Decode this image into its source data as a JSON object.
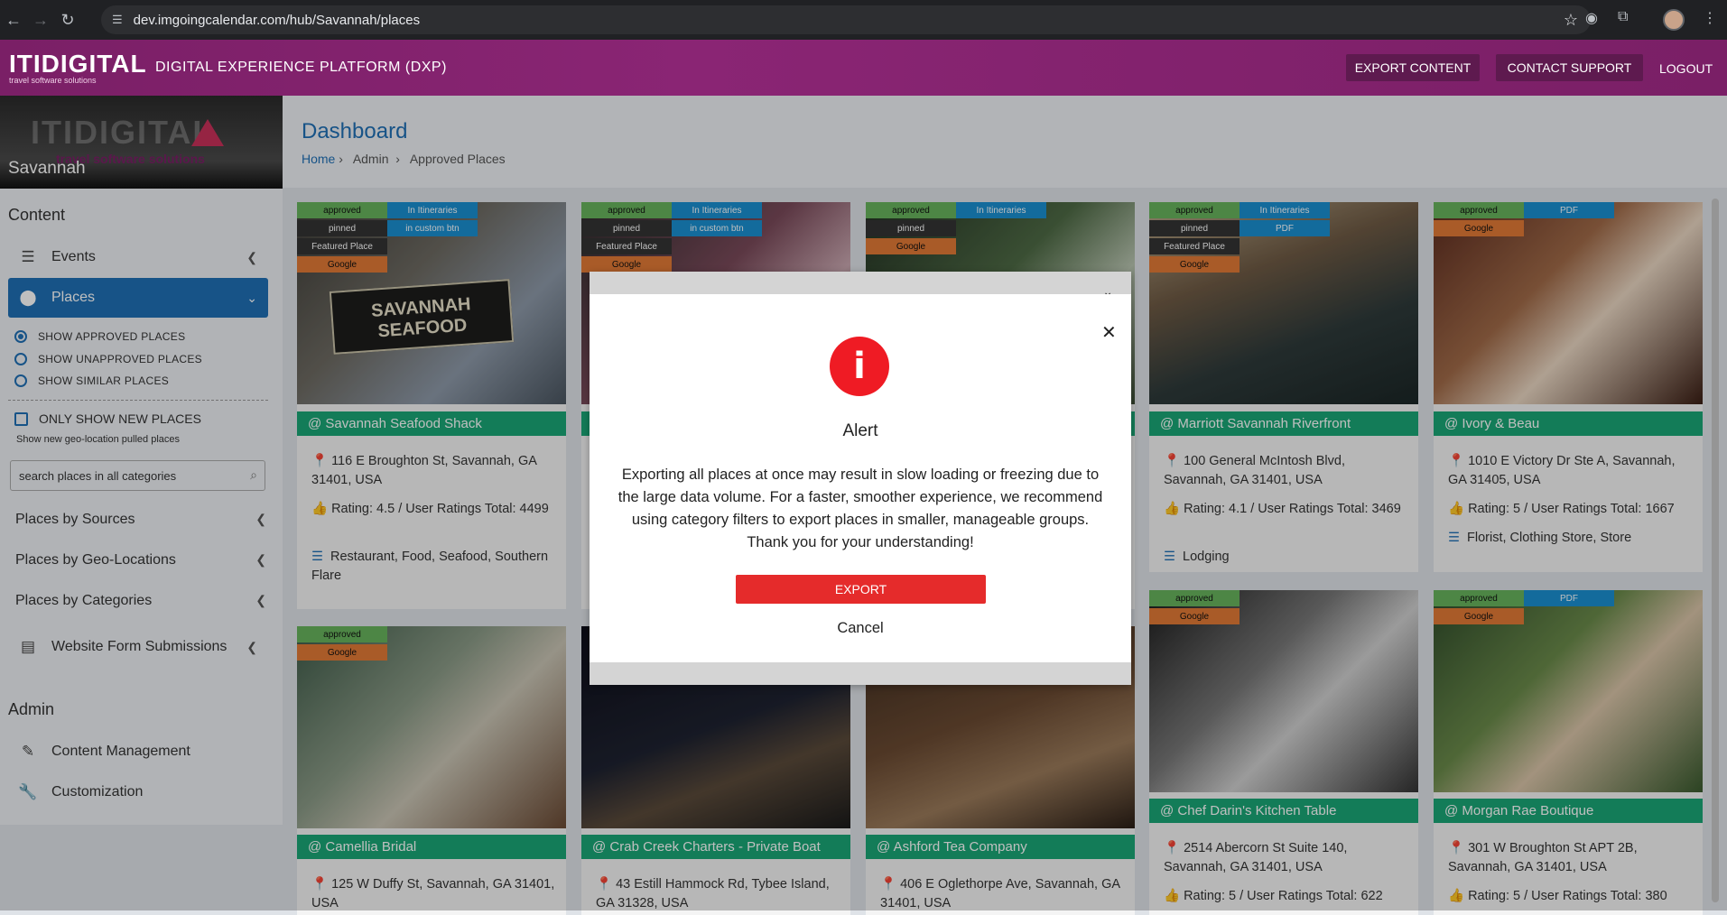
{
  "browser": {
    "url": "dev.imgoingcalendar.com/hub/Savannah/places"
  },
  "header": {
    "logo_main": "ITIDIGITAL",
    "logo_sub": "travel software solutions",
    "title": "DIGITAL EXPERIENCE PLATFORM (DXP)",
    "export_btn": "EXPORT CONTENT",
    "support_btn": "CONTACT SUPPORT",
    "logout": "LOGOUT",
    "accent": "#7a1f66"
  },
  "sidebar": {
    "banner_watermark": "ITIDIGITAL",
    "banner_sub": "travel software solutions",
    "city": "Savannah",
    "content_heading": "Content",
    "events": "Events",
    "places": "Places",
    "show_approved": "SHOW APPROVED PLACES",
    "show_unapproved": "SHOW UNAPPROVED PLACES",
    "show_similar": "SHOW SIMILAR PLACES",
    "only_new": "ONLY SHOW NEW PLACES",
    "only_new_hint": "Show new geo-location pulled places",
    "search_placeholder": "search places in all categories",
    "by_sources": "Places by Sources",
    "by_geo": "Places by Geo-Locations",
    "by_categories": "Places by Categories",
    "form_submissions": "Website Form Submissions",
    "admin_heading": "Admin",
    "content_mgmt": "Content Management",
    "customization": "Customization"
  },
  "main": {
    "title": "Dashboard",
    "crumb_home": "Home",
    "crumb_admin": "Admin",
    "crumb_current": "Approved Places"
  },
  "tags": {
    "approved": "approved",
    "pinned": "pinned",
    "featured": "Featured Place",
    "google": "Google",
    "in_itineraries": "In Itineraries",
    "in_custom_btn": "in custom btn",
    "pdf": "PDF"
  },
  "cards": {
    "c1": {
      "name": "@ Savannah Seafood Shack",
      "addr": "116 E Broughton St, Savannah, GA 31401, USA",
      "rating": "Rating: 4.5 / User Ratings Total: 4499",
      "cats": "Restaurant, Food, Seafood, Southern Flare",
      "sign": "SAVANNAH SEAFOOD"
    },
    "c4": {
      "name": "@ Marriott Savannah Riverfront",
      "addr": "100 General McIntosh Blvd, Savannah, GA 31401, USA",
      "rating": "Rating: 4.1 / User Ratings Total: 3469",
      "cats": "Lodging"
    },
    "c5": {
      "name": "@ Ivory & Beau",
      "addr": "1010 E Victory Dr Ste A, Savannah, GA 31405, USA",
      "rating": "Rating: 5 / User Ratings Total: 1667",
      "cats": "Florist, Clothing Store, Store"
    },
    "c6": {
      "name": "@ Camellia Bridal",
      "addr": "125 W Duffy St, Savannah, GA 31401, USA"
    },
    "c7": {
      "name": "@ Crab Creek Charters - Private Boat",
      "addr": "43 Estill Hammock Rd, Tybee Island, GA 31328, USA"
    },
    "c8": {
      "name": "@ Ashford Tea Company",
      "addr": "406 E Oglethorpe Ave, Savannah, GA 31401, USA"
    },
    "c9": {
      "name": "@ Chef Darin's Kitchen Table",
      "addr": "2514 Abercorn St Suite 140, Savannah, GA 31401, USA",
      "rating": "Rating: 5 / User Ratings Total: 622"
    },
    "c10": {
      "name": "@ Morgan Rae Boutique",
      "addr": "301 W Broughton St APT 2B, Savannah, GA 31401, USA",
      "rating": "Rating: 5 / User Ratings Total: 380"
    }
  },
  "modal": {
    "title": "Alert",
    "message": "Exporting all places at once may result in slow loading or freezing due to the large data volume. For a faster, smoother experience, we recommend using category filters to export places in smaller, manageable groups. Thank you for your understanding!",
    "export": "EXPORT",
    "cancel": "Cancel"
  }
}
